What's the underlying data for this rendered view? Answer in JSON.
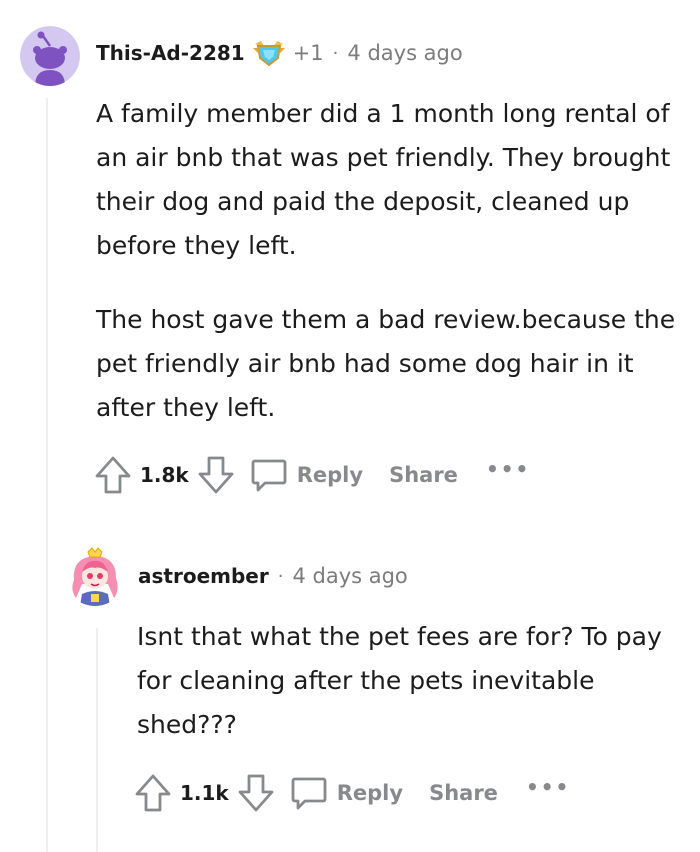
{
  "comment": {
    "username": "This-Ad-2281",
    "award_icon": "award-icon",
    "karma": "+1",
    "time": "4 days ago",
    "paragraphs": [
      "A family member did a 1 month long rental of an air bnb that was pet friendly. They brought their dog and paid the deposit, cleaned up before they left.",
      "The host gave them a bad review.because the pet friendly air bnb had some dog hair in it after they left."
    ],
    "score": "1.8k",
    "reply_label": "Reply",
    "share_label": "Share",
    "more_label": "•••"
  },
  "reply": {
    "username": "astroember",
    "time": "4 days ago",
    "paragraphs": [
      "Isnt that what the pet fees are for? To pay for cleaning after the pets inevitable shed???"
    ],
    "score": "1.1k",
    "reply_label": "Reply",
    "share_label": "Share",
    "more_label": "•••"
  },
  "colors": {
    "avatar_bg": "#d4c8f0",
    "avatar_snoo": "#7e53c1",
    "meta_text": "#7c7c7c",
    "action_text": "#878a8c",
    "rail": "#edeff1"
  }
}
